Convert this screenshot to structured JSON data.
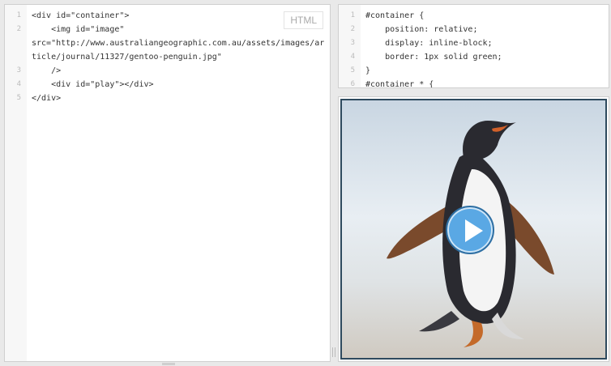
{
  "html_editor": {
    "language_badge": "HTML",
    "lines": [
      {
        "n": "1",
        "text": "<div id=\"container\">"
      },
      {
        "n": "2",
        "text": "    <img id=\"image\""
      },
      {
        "n": "",
        "text": "src=\"http://www.australiangeographic.com.au/assets/images/ar"
      },
      {
        "n": "",
        "text": "ticle/journal/11327/gentoo-penguin.jpg\""
      },
      {
        "n": "3",
        "text": "    />"
      },
      {
        "n": "4",
        "text": "    <div id=\"play\"></div>"
      },
      {
        "n": "5",
        "text": "</div>"
      }
    ]
  },
  "css_editor": {
    "lines": [
      {
        "n": "1",
        "text": "#container {"
      },
      {
        "n": "2",
        "text": "    position: relative;"
      },
      {
        "n": "3",
        "text": "    display: inline-block;"
      },
      {
        "n": "4",
        "text": "    border: 1px solid green;"
      },
      {
        "n": "5",
        "text": "}"
      },
      {
        "n": "6",
        "text": "#container * {"
      }
    ]
  },
  "result": {
    "image_subject": "gentoo-penguin",
    "play_button_color": "#5aa8e4",
    "frame_color": "#2e4a5e"
  }
}
